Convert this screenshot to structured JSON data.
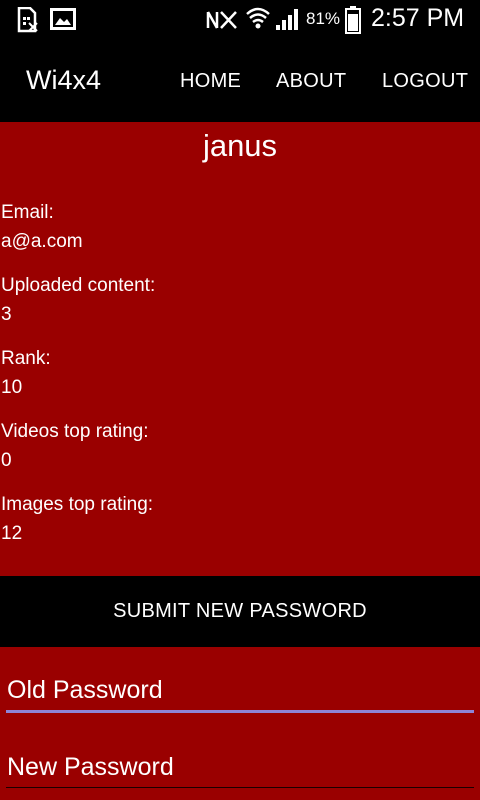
{
  "status_bar": {
    "icons": [
      "sim-card-icon",
      "image-icon",
      "nfc-muted-icon",
      "wifi-icon",
      "signal-icon",
      "battery-icon"
    ],
    "battery_percent": "81%",
    "clock": "2:57 PM"
  },
  "app_bar": {
    "title": "Wi4x4",
    "nav": {
      "home": "HOME",
      "about": "ABOUT",
      "logout": "LOGOUT"
    }
  },
  "profile": {
    "username": "janus",
    "email": {
      "label": "Email:",
      "value": "a@a.com"
    },
    "uploaded": {
      "label": "Uploaded content:",
      "value": "3"
    },
    "rank": {
      "label": "Rank:",
      "value": "10"
    },
    "videos_top": {
      "label": "Videos top rating:",
      "value": "0"
    },
    "images_top": {
      "label": "Images top rating:",
      "value": "12"
    }
  },
  "password_form": {
    "submit_label": "SUBMIT NEW PASSWORD",
    "old_password_placeholder": "Old Password",
    "new_password_placeholder": "New Password"
  },
  "colors": {
    "background": "#9a0000",
    "bars": "#000000",
    "text": "#ffffff",
    "focus_underline": "#8e84d6"
  }
}
